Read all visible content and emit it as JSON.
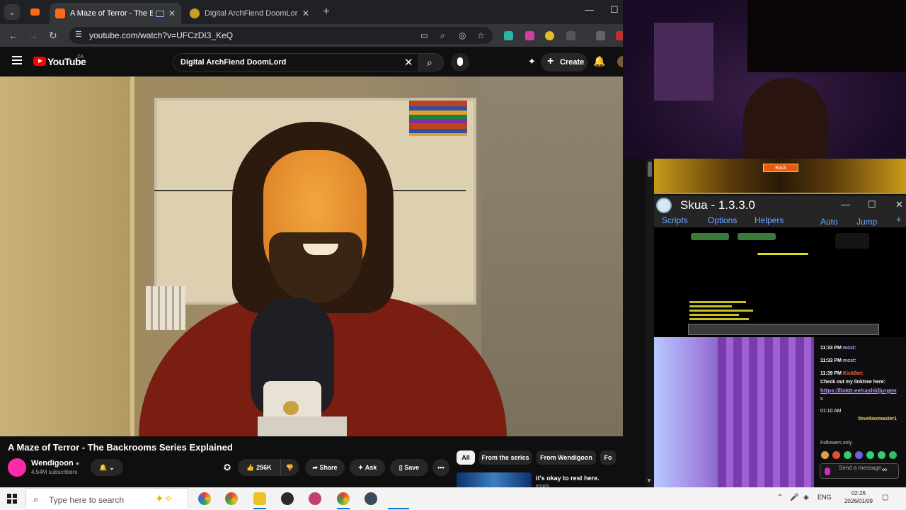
{
  "browser": {
    "tabs": [
      {
        "title": "A Maze of Terror - The Backrooms Series Explained",
        "active": true
      },
      {
        "title": "Digital ArchFiend DoomLord (Skua)",
        "active": false
      }
    ],
    "url": "youtube.com/watch?v=UFCzDI3_KeQ"
  },
  "youtube": {
    "logo_text": "YouTube",
    "country_code": "ZA",
    "search_query": "Digital ArchFiend DoomLord",
    "create_label": "Create",
    "video": {
      "title": "A Maze of Terror - The Backrooms Series Explained",
      "channel": "Wendigoon",
      "subscribers": "4.54M subscribers",
      "likes": "256K",
      "share_label": "Share",
      "ask_label": "Ask",
      "save_label": "Save"
    },
    "chips": [
      "All",
      "From the series",
      "From Wendigoon",
      "Fo"
    ],
    "reco": {
      "title": "it's okay to rest here.",
      "subtitle": "empty"
    }
  },
  "overlay": {
    "back_button": "Back",
    "skua": {
      "title": "Skua - 1.3.3.0",
      "menu": [
        "Scripts",
        "Options",
        "Helpers",
        "Auto",
        "Jump"
      ]
    }
  },
  "chat": {
    "messages": [
      {
        "time": "11:33 PM",
        "user": "mcst:"
      },
      {
        "time": "11:33 PM",
        "user": "mcst:"
      },
      {
        "time": "11:39 PM",
        "user": "KickBot:",
        "text": "Check out my linktree here:",
        "link": "https://linktr.ee/rashidjurgen",
        "link_tail": "s"
      },
      {
        "time": "01:10 AM",
        "user": "ilovekosmaster1"
      }
    ],
    "followers_only": "Followers only",
    "input_placeholder": "Send a message"
  },
  "taskbar": {
    "search_placeholder": "Type here to search",
    "language": "ENG",
    "time": "02:26",
    "date": "2026/01/09"
  },
  "colors": {
    "yt_red": "#ff0000",
    "chat_link": "#bf94ff",
    "skua_menu": "#6aa8ff",
    "windows_accent": "#0078d4"
  }
}
